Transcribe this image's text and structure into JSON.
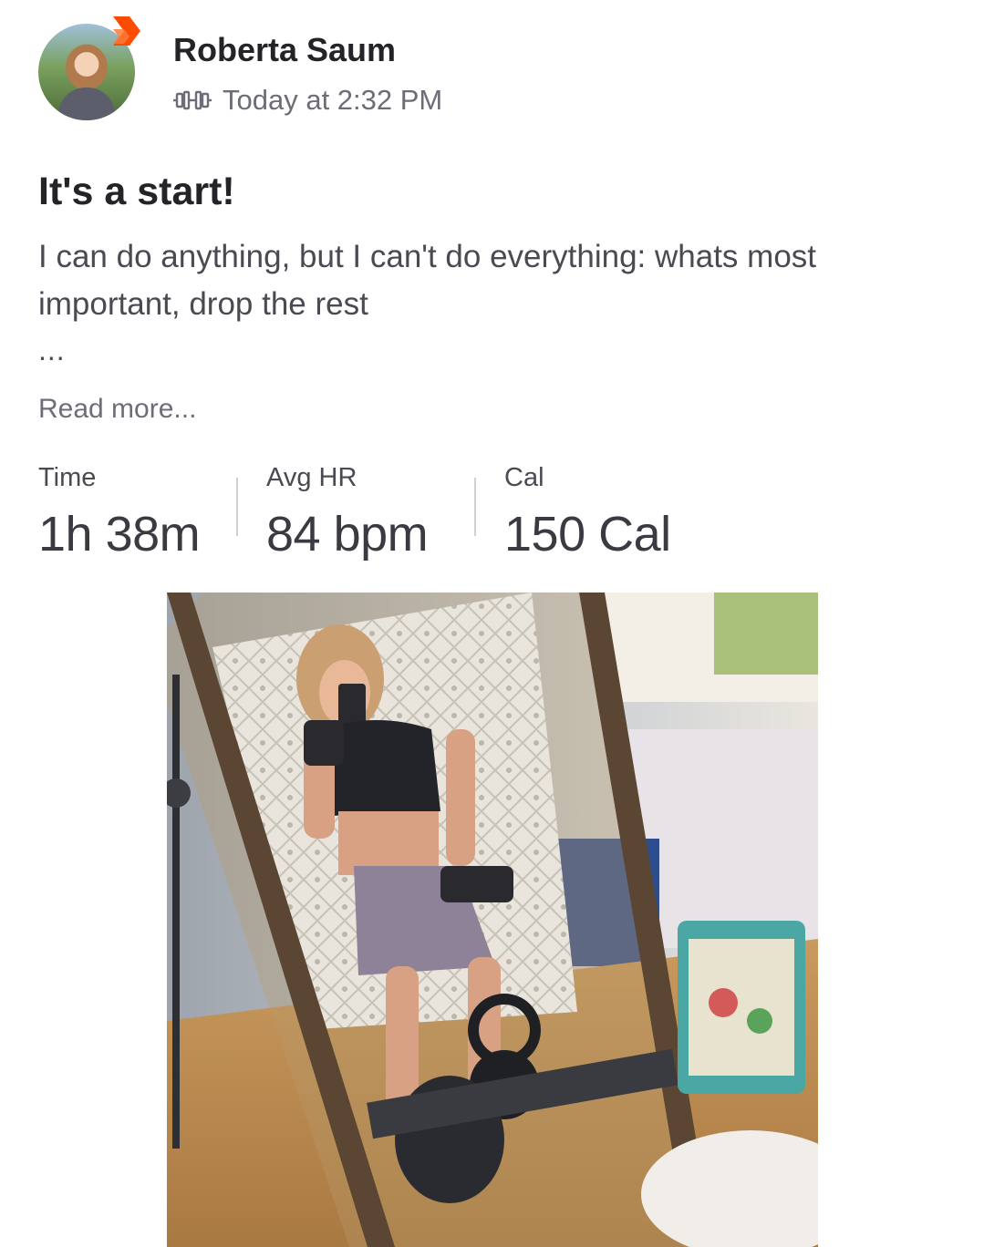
{
  "post": {
    "author_name": "Roberta Saum",
    "timestamp": "Today at 2:32 PM",
    "activity_icon": "dumbbell-icon",
    "title": "It's a start!",
    "description": "I can do anything, but I can't do everything: whats most important, drop the rest",
    "ellipsis": "...",
    "read_more": "Read more..."
  },
  "stats": [
    {
      "label": "Time",
      "value": "1h 38m"
    },
    {
      "label": "Avg HR",
      "value": "84 bpm"
    },
    {
      "label": "Cal",
      "value": "150 Cal"
    }
  ],
  "colors": {
    "brand_orange": "#fc4c02",
    "text_primary": "#242428",
    "text_secondary": "#6d6d78"
  }
}
